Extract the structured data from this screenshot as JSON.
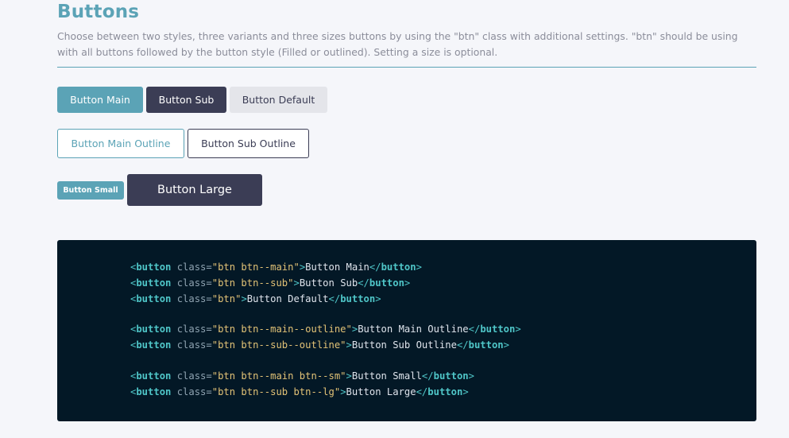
{
  "section": {
    "title": "Buttons",
    "description": "Choose between two styles, three variants and three sizes buttons by using the \"btn\" class with additional settings. \"btn\" should be using with all buttons followed by the button style (Filled or outlined). Setting a size is optional."
  },
  "buttons": {
    "main": "Button Main",
    "sub": "Button Sub",
    "default": "Button Default",
    "main_outline": "Button Main Outline",
    "sub_outline": "Button Sub Outline",
    "small": "Button Small",
    "large": "Button Large"
  },
  "colors": {
    "accent": "#5ba3b6",
    "dark": "#3b3d55",
    "default_bg": "#e4e5ea",
    "code_bg": "#031826",
    "page_bg": "#f5f6fa"
  },
  "code": {
    "tag": "button",
    "attr": "class",
    "lines": [
      {
        "cls": "\"btn btn--main\"",
        "text": "Button Main"
      },
      {
        "cls": "\"btn btn--sub\"",
        "text": "Button Sub"
      },
      {
        "cls": "\"btn\"",
        "text": "Button Default"
      },
      {
        "cls": "\"btn btn--main--outline\"",
        "text": "Button Main Outline"
      },
      {
        "cls": "\"btn btn--sub--outline\"",
        "text": "Button Sub Outline"
      },
      {
        "cls": "\"btn btn--main btn--sm\"",
        "text": "Button Small"
      },
      {
        "cls": "\"btn btn--sub btn--lg\"",
        "text": "Button Large"
      }
    ],
    "groups": [
      [
        0,
        1,
        2
      ],
      [
        3,
        4
      ],
      [
        5,
        6
      ]
    ]
  }
}
